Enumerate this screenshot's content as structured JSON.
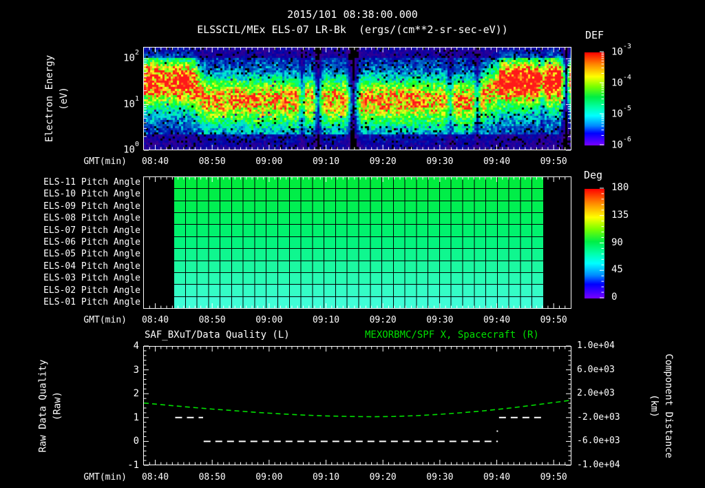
{
  "header": {
    "datetime": "2015/101 08:38:00.000",
    "instrument_title": "ELSSCIL/MEx ELS-07 LR-Bk",
    "units": "(ergs/(cm**2-sr-sec-eV))"
  },
  "colors": {
    "background": "#000000",
    "text": "#ffffff",
    "accent_green": "#00e000",
    "panel_border": "#ffffff"
  },
  "time_axis": {
    "label": "GMT(min)",
    "start_gmt": "08:38",
    "span_min": 75,
    "ticks": [
      {
        "min": 2,
        "label": "08:40"
      },
      {
        "min": 12,
        "label": "08:50"
      },
      {
        "min": 22,
        "label": "09:00"
      },
      {
        "min": 32,
        "label": "09:10"
      },
      {
        "min": 42,
        "label": "09:20"
      },
      {
        "min": 52,
        "label": "09:30"
      },
      {
        "min": 62,
        "label": "09:40"
      },
      {
        "min": 72,
        "label": "09:50"
      }
    ]
  },
  "spectrogram": {
    "ylabel_line1": "Electron Energy",
    "ylabel_line2": "(eV)",
    "ytick_exponents": [
      "2",
      "1",
      "0"
    ],
    "colorbar": {
      "label": "DEF",
      "tick_exponents": [
        "-3",
        "-4",
        "-5",
        "-6"
      ]
    }
  },
  "pitch_panel": {
    "fill_start_min": 5.4,
    "fill_end_min": 70.2,
    "columns": 32,
    "rows": [
      {
        "label": "ELS-11 Pitch Angle",
        "color": "#00ec3e",
        "approx_pitch_deg": 106
      },
      {
        "label": "ELS-10 Pitch Angle",
        "color": "#00ee48",
        "approx_pitch_deg": 103
      },
      {
        "label": "ELS-09 Pitch Angle",
        "color": "#00f053",
        "approx_pitch_deg": 100
      },
      {
        "label": "ELS-08 Pitch Angle",
        "color": "#00f260",
        "approx_pitch_deg": 97
      },
      {
        "label": "ELS-07 Pitch Angle",
        "color": "#00f36e",
        "approx_pitch_deg": 94
      },
      {
        "label": "ELS-06 Pitch Angle",
        "color": "#03f57e",
        "approx_pitch_deg": 91
      },
      {
        "label": "ELS-05 Pitch Angle",
        "color": "#0ff78f",
        "approx_pitch_deg": 88
      },
      {
        "label": "ELS-04 Pitch Angle",
        "color": "#1cf9a1",
        "approx_pitch_deg": 85
      },
      {
        "label": "ELS-03 Pitch Angle",
        "color": "#28fbb3",
        "approx_pitch_deg": 82
      },
      {
        "label": "ELS-02 Pitch Angle",
        "color": "#34fdc6",
        "approx_pitch_deg": 79
      },
      {
        "label": "ELS-01 Pitch Angle",
        "color": "#3fffd7",
        "approx_pitch_deg": 76
      }
    ],
    "colorbar": {
      "label": "Deg",
      "ticks": [
        "180",
        "135",
        "90",
        "45",
        "0"
      ]
    }
  },
  "bottom_panel": {
    "title_left": "SAF_BXuT/Data Quality (L)",
    "title_right": "MEXORBMC/SPF X, Spacecraft (R)",
    "ylabel_left_line1": "Raw Data Quality",
    "ylabel_left_line2": "(Raw)",
    "ylabel_right_line1": "Component Distance",
    "ylabel_right_line2": "(km)",
    "left_ticks": [
      "4",
      "3",
      "2",
      "1",
      "0",
      "-1"
    ],
    "right_ticks": [
      "1.0e+04",
      "6.0e+03",
      "2.0e+03",
      "-2.0e+03",
      "-6.0e+03",
      "-1.0e+04"
    ]
  },
  "chart_data": [
    {
      "type": "heatmap",
      "name": "electron-energy-spectrogram",
      "title": "ELSSCIL/MEx ELS-07 LR-Bk",
      "x_axis": "GMT from 08:38 to ~09:53, t in minutes after 08:38",
      "y_axis": "Electron Energy (eV), log scale 1 to ~180",
      "z_axis": "DEF ergs/(cm**2-sr-sec-eV), log color scale 1e-6 (purple) to 1e-3 (red)",
      "background_level": "blue noise ~1e-6 to 1e-5",
      "main_band_center": [
        {
          "t": 0,
          "log10_ev": 1.56
        },
        {
          "t": 8,
          "log10_ev": 1.54
        },
        {
          "t": 11,
          "log10_ev": 1.18
        },
        {
          "t": 58,
          "log10_ev": 1.15
        },
        {
          "t": 63,
          "log10_ev": 1.5
        },
        {
          "t": 75,
          "log10_ev": 1.52
        }
      ],
      "bright_blobs": [
        {
          "t_range": [
            0,
            9.5
          ],
          "log10_ev_center": 1.58,
          "peak_def": "~1e-4 yellow-green"
        },
        {
          "t_range": [
            62.5,
            75
          ],
          "log10_ev_center": 1.62,
          "peak_def": "~2e-4 orange-red"
        }
      ],
      "dark_gaps": [
        {
          "t": 27.8,
          "w": 0.8,
          "d": 0.5
        },
        {
          "t": 30.6,
          "w": 1.0,
          "d": 0.25
        },
        {
          "t": 36.8,
          "w": 1.4,
          "d": 0.08
        },
        {
          "t": 53.8,
          "w": 0.9,
          "d": 0.5
        },
        {
          "t": 58.6,
          "w": 0.8,
          "d": 0.45
        },
        {
          "t": 70.0,
          "w": 0.7,
          "d": 0.6
        },
        {
          "t": 74.2,
          "w": 1.0,
          "d": 0.12
        }
      ]
    },
    {
      "type": "heatmap",
      "name": "els-pitch-angle-rows",
      "x_range_min_after_0838": [
        5.4,
        70.2
      ],
      "value_scale": "Deg 0-180",
      "row_pitch_deg_top_to_bottom": [
        106,
        103,
        100,
        97,
        94,
        91,
        88,
        85,
        82,
        79,
        76
      ]
    },
    {
      "type": "line",
      "name": "SAF_BXuT/Data Quality (L)",
      "axis": "left",
      "units": "Raw",
      "x_unit": "minutes after 08:38",
      "segments": [
        {
          "t_range": [
            5.5,
            10.4
          ],
          "value": 1
        },
        {
          "t_range": [
            10.5,
            62.2
          ],
          "value": 0
        },
        {
          "t_range": [
            62.4,
            70.4
          ],
          "value": 1
        }
      ],
      "dot": {
        "t": 62.1,
        "value": 0.43
      }
    },
    {
      "type": "line",
      "name": "MEXORBMC/SPF X, Spacecraft (R)",
      "axis": "right",
      "units": "km",
      "x_unit": "minutes after 08:38",
      "ylim": [
        -10000,
        10000
      ],
      "points": [
        [
          0,
          440
        ],
        [
          4,
          80
        ],
        [
          8,
          -260
        ],
        [
          12,
          -580
        ],
        [
          16,
          -860
        ],
        [
          20,
          -1140
        ],
        [
          24,
          -1380
        ],
        [
          28,
          -1580
        ],
        [
          32,
          -1720
        ],
        [
          36,
          -1820
        ],
        [
          40,
          -1860
        ],
        [
          44,
          -1820
        ],
        [
          48,
          -1680
        ],
        [
          52,
          -1460
        ],
        [
          56,
          -1180
        ],
        [
          60,
          -840
        ],
        [
          64,
          -440
        ],
        [
          68,
          20
        ],
        [
          71,
          400
        ],
        [
          73,
          640
        ],
        [
          75,
          900
        ]
      ]
    }
  ]
}
